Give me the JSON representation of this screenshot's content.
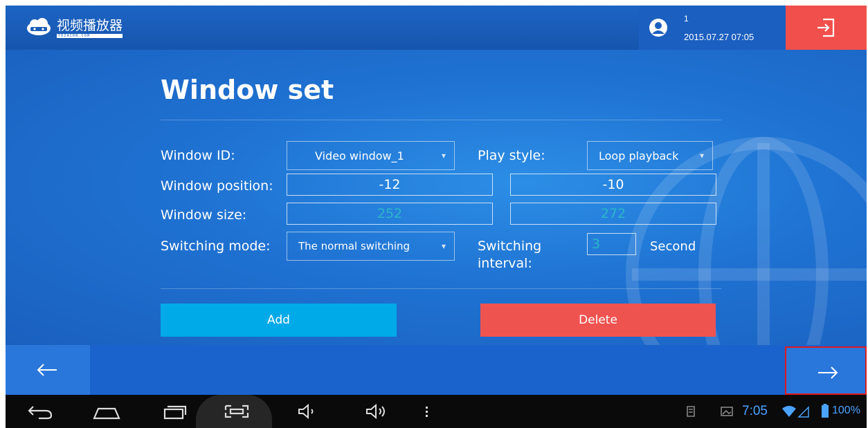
{
  "app": {
    "logo_title": "视频播放器",
    "logo_subtitle": "YDZACRN.COM"
  },
  "header": {
    "user_name": "1",
    "datetime": "2015.07.27 07:05",
    "logout_icon": "logout-icon"
  },
  "page": {
    "title": "Window set"
  },
  "form": {
    "window_id_label": "Window ID:",
    "window_id_value": "Video window_1",
    "play_style_label": "Play style:",
    "play_style_value": "Loop playback",
    "window_position_label": "Window position:",
    "position_x": "-12",
    "position_y": "-10",
    "window_size_label": "Window size:",
    "size_w": "252",
    "size_h": "272",
    "switching_mode_label": "Switching mode:",
    "switching_mode_value": "The normal switching",
    "switching_interval_label_1": "Switching",
    "switching_interval_label_2": "interval:",
    "switching_interval_value": "3",
    "second_label": "Second"
  },
  "actions": {
    "add_label": "Add",
    "delete_label": "Delete"
  },
  "nav": {
    "back_icon": "arrow-left-icon",
    "next_icon": "arrow-right-icon"
  },
  "system": {
    "time": "7:05",
    "battery": "100%"
  },
  "colors": {
    "header_bg": "#1d64c4",
    "main_bg": "#1f72d2",
    "logout_bg": "#f14f4c",
    "add_bg": "#00a9e8",
    "delete_bg": "#ef5350",
    "highlight_border": "#e0191e",
    "status_blue": "#4aa3ff"
  }
}
